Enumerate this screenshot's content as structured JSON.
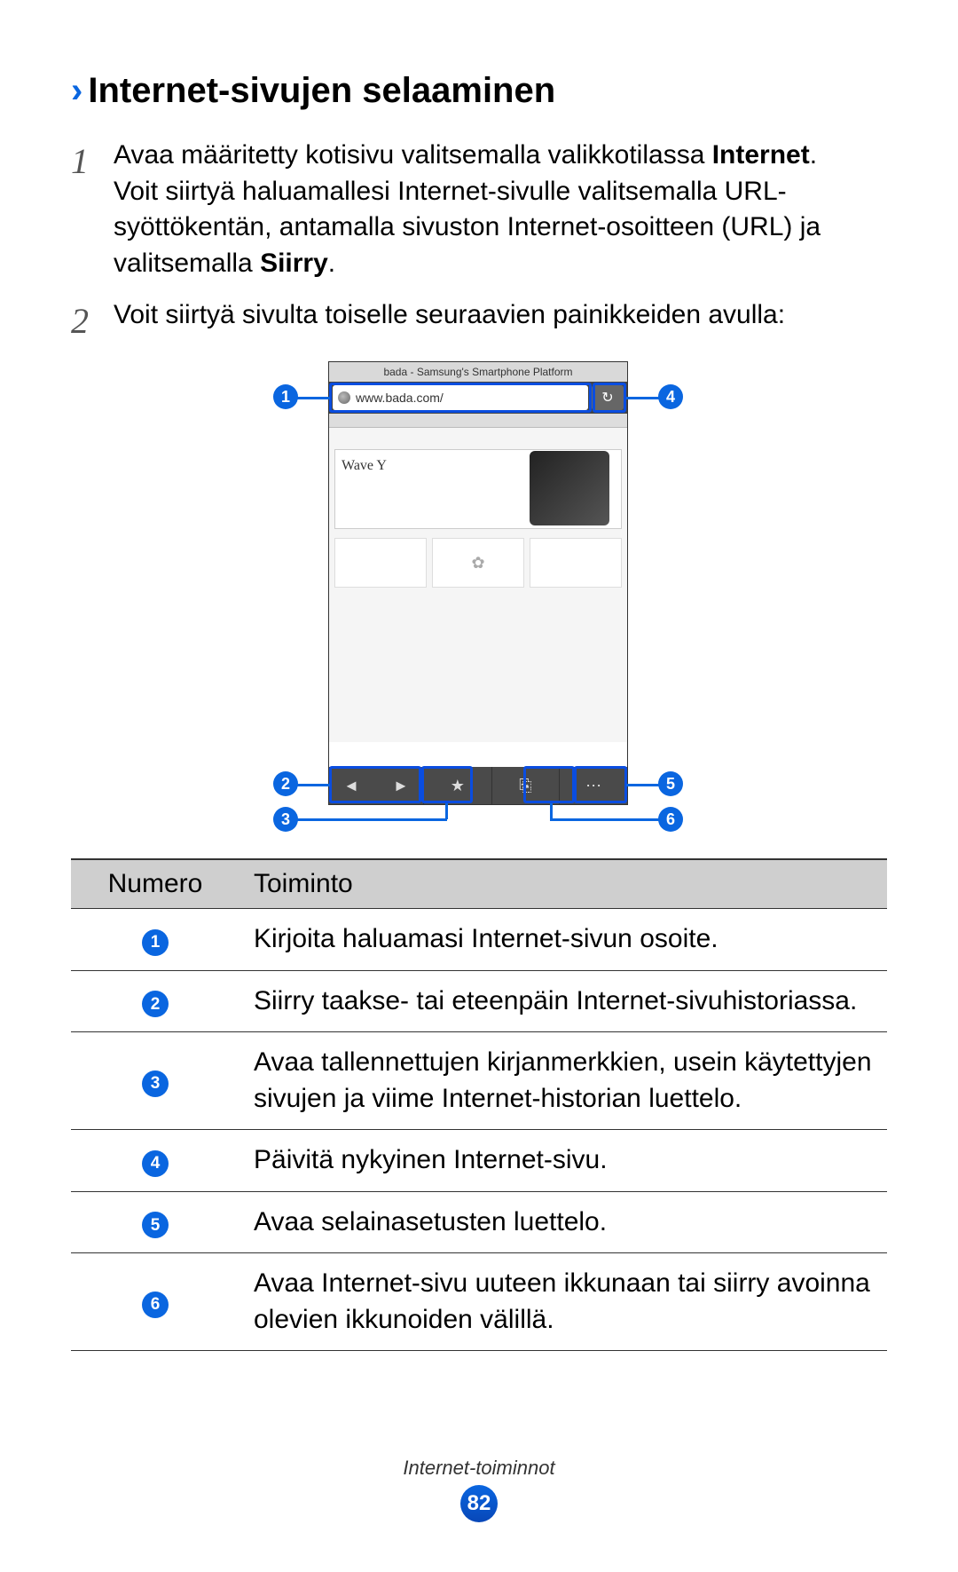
{
  "section": {
    "chevron": "›",
    "title": "Internet-sivujen selaaminen"
  },
  "steps": {
    "s1_num": "1",
    "s1_pre": "Avaa määritetty kotisivu valitsemalla valikkotilassa ",
    "s1_bold": "Internet",
    "s1_post": ".",
    "s1_line2a": "Voit siirtyä haluamallesi Internet-sivulle valitsemalla URL-syöttökentän, antamalla sivuston Internet-osoitteen (URL) ja valitsemalla ",
    "s1_line2_bold": "Siirry",
    "s1_line2b": ".",
    "s2_num": "2",
    "s2_text": "Voit siirtyä sivulta toiselle seuraavien painikkeiden avulla:"
  },
  "shot": {
    "titlebar": "bada - Samsung's Smartphone Platform",
    "url": "www.bada.com/",
    "wave": "Wave Y",
    "nav_back": "◄",
    "nav_fwd": "►",
    "star": "★",
    "windows": "⎘",
    "more": "⋯",
    "refresh": "↻"
  },
  "callouts": {
    "c1": "1",
    "c2": "2",
    "c3": "3",
    "c4": "4",
    "c5": "5",
    "c6": "6"
  },
  "table": {
    "h1": "Numero",
    "h2": "Toiminto",
    "r1": "Kirjoita haluamasi Internet-sivun osoite.",
    "r2": "Siirry taakse- tai eteenpäin Internet-sivuhistoriassa.",
    "r3": "Avaa tallennettujen kirjanmerkkien, usein käytettyjen sivujen ja viime Internet-historian luettelo.",
    "r4": "Päivitä nykyinen Internet-sivu.",
    "r5": "Avaa selainasetusten luettelo.",
    "r6": "Avaa Internet-sivu uuteen ikkunaan tai siirry avoinna olevien ikkunoiden välillä."
  },
  "footer": {
    "label": "Internet-toiminnot",
    "page": "82"
  }
}
